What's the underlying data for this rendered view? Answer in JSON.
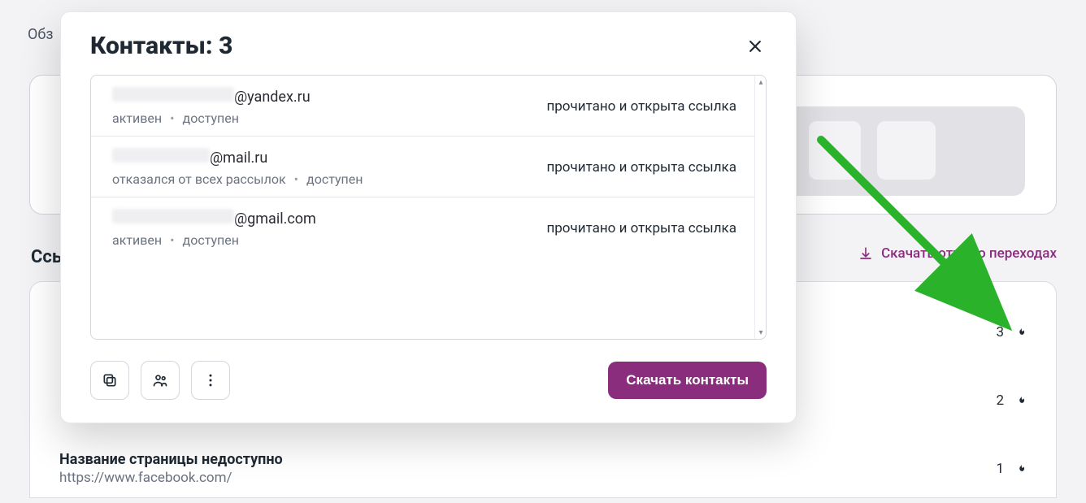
{
  "background": {
    "top_text": "Обз",
    "links_label": "Ссы",
    "download_report": "Скачать отчет о переходах",
    "list_items": [
      {
        "title": "",
        "sub": "",
        "count": "3"
      },
      {
        "title": "",
        "sub": "",
        "count": "2"
      },
      {
        "title": "Название страницы недоступно",
        "sub": "https://www.facebook.com/",
        "count": "1"
      }
    ]
  },
  "modal": {
    "title": "Контакты: 3",
    "contacts": [
      {
        "domain": "@yandex.ru",
        "meta_a": "активен",
        "meta_b": "доступен",
        "status": "прочитано и открыта ссылка"
      },
      {
        "domain": "@mail.ru",
        "meta_a": "отказался от всех рассылок",
        "meta_b": "доступен",
        "status": "прочитано и открыта ссылка"
      },
      {
        "domain": "@gmail.com",
        "meta_a": "активен",
        "meta_b": "доступен",
        "status": "прочитано и открыта ссылка"
      }
    ],
    "download_button": "Скачать контакты"
  }
}
